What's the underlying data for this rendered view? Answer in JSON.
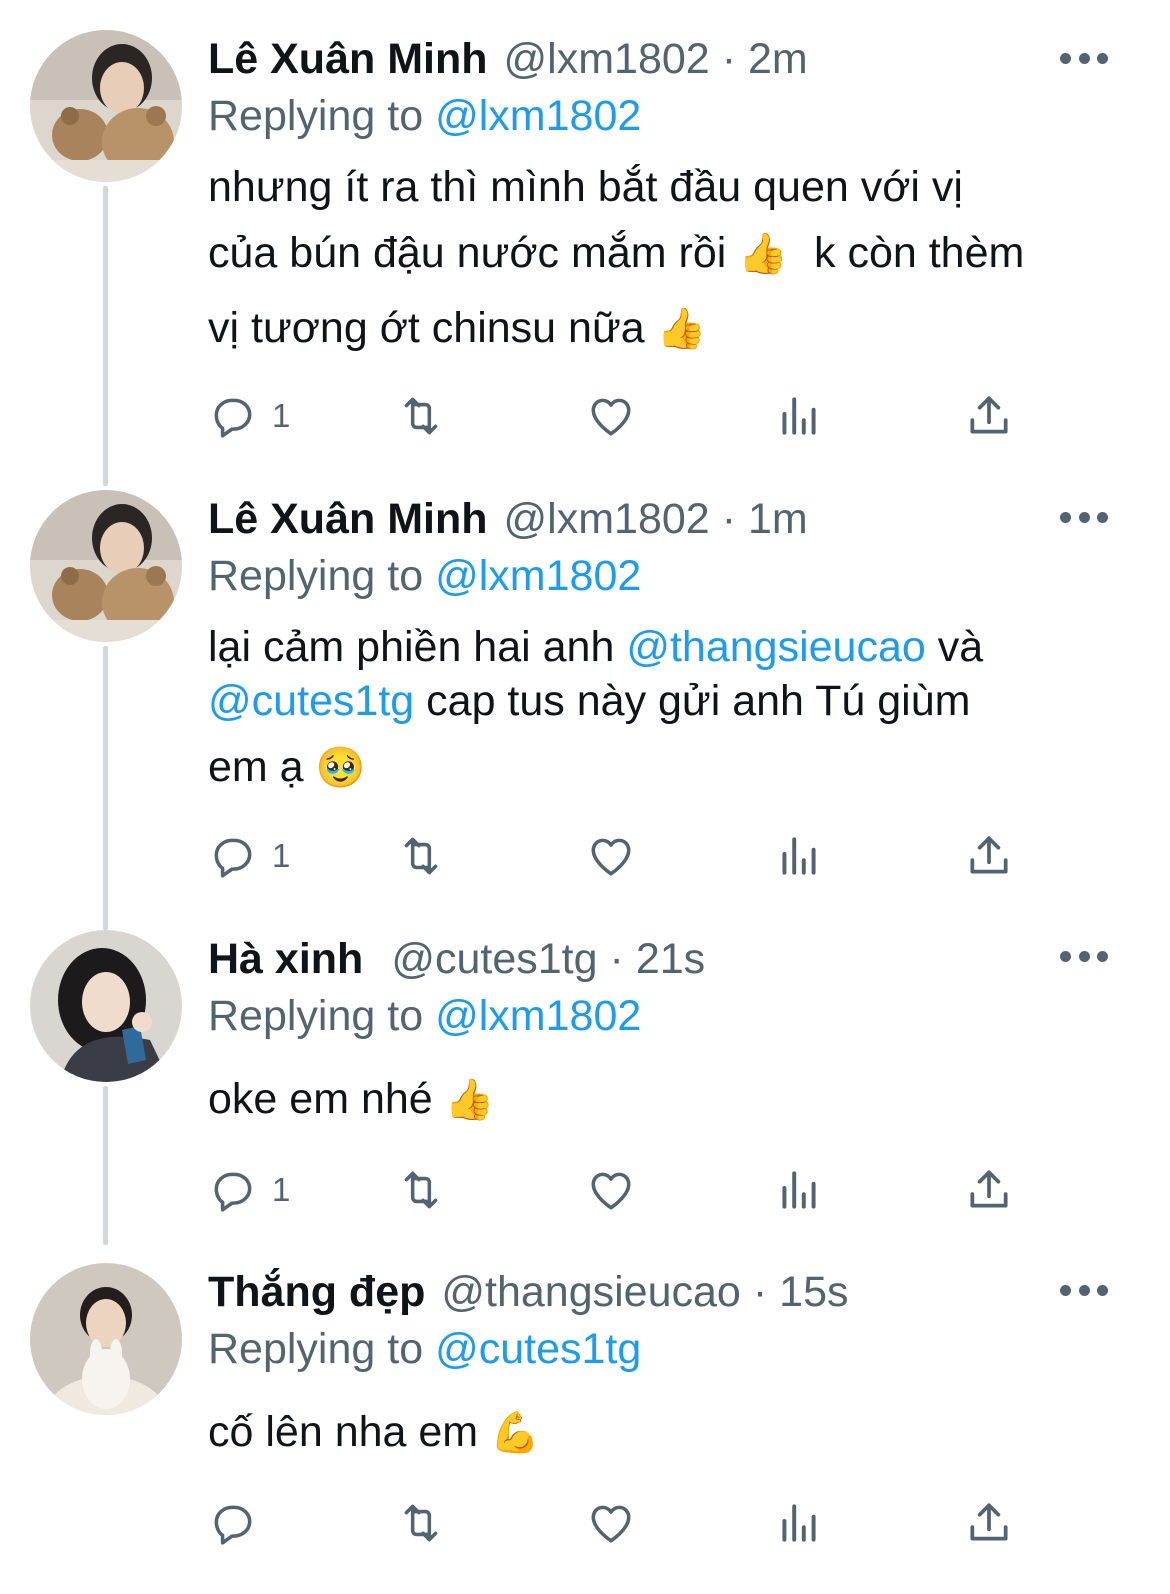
{
  "tweets": [
    {
      "display_name": "Lê Xuân Minh",
      "handle": "@lxm1802",
      "separator": "·",
      "time": "2m",
      "replying_prefix": "Replying to",
      "replying_to": "@lxm1802",
      "text_lines": [
        "nhưng ít ra thì mình bắt đầu quen với vị",
        "của bún đậu nước mắm rồi",
        "k còn thèm",
        "vị tương ớt chinsu nữa"
      ],
      "emojis": [
        "👍",
        "👍"
      ],
      "reply_count": "1"
    },
    {
      "display_name": "Lê Xuân Minh",
      "handle": "@lxm1802",
      "separator": "·",
      "time": "1m",
      "replying_prefix": "Replying to",
      "replying_to": "@lxm1802",
      "text_parts": [
        "lại cảm phiền hai anh ",
        "@thangsieucao",
        " và",
        "@cutes1tg",
        " cap tus này gửi anh Tú giùm",
        "em ạ "
      ],
      "emojis": [
        "🥹"
      ],
      "reply_count": "1"
    },
    {
      "display_name": "Hà xinh",
      "handle": "@cutes1tg",
      "separator": "·",
      "time": "21s",
      "replying_prefix": "Replying to",
      "replying_to": "@lxm1802",
      "text": "oke em nhé ",
      "emojis": [
        "👍"
      ],
      "reply_count": "1"
    },
    {
      "display_name": "Thắng đẹp",
      "handle": "@thangsieucao",
      "separator": "·",
      "time": "15s",
      "replying_prefix": "Replying to",
      "replying_to": "@cutes1tg",
      "text": "cố lên nha em ",
      "emojis": [
        "💪"
      ],
      "reply_count": ""
    }
  ],
  "icons": {
    "reply": "reply-bubble-icon",
    "retweet": "retweet-icon",
    "like": "heart-icon",
    "views": "views-bar-chart-icon",
    "share": "share-upload-icon",
    "more": "more-dots-icon"
  },
  "colors": {
    "text": "#0f1419",
    "secondary": "#536471",
    "accent": "#1d9bf0",
    "thread_line": "#cfd9de"
  }
}
